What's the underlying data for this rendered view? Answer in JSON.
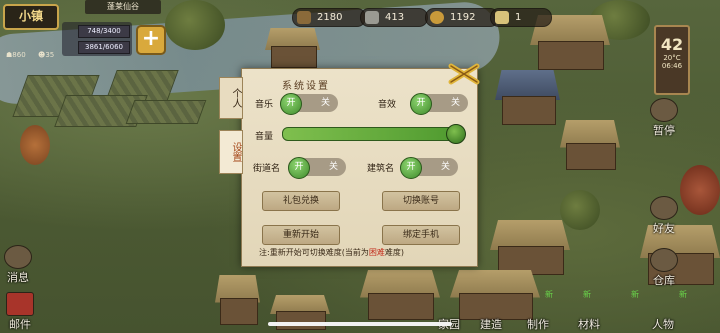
{
  "hud": {
    "town_label": "小镇",
    "place_name": "蓬莱仙谷",
    "population": "860",
    "workers": "35",
    "stat_top": "748/3400",
    "stat_bottom": "3861/6060",
    "plus_label": "+"
  },
  "resources": [
    {
      "value": "2180",
      "icon": "wood-log-icon",
      "color": "#8a6a3a"
    },
    {
      "value": "413",
      "icon": "stone-icon",
      "color": "#9a9a92"
    },
    {
      "value": "1192",
      "icon": "coin-icon",
      "color": "#c99a3a"
    },
    {
      "value": "1",
      "icon": "scroll-icon",
      "color": "#d8c27a"
    }
  ],
  "clock": {
    "day": "42",
    "temp": "20°C",
    "time": "06:46"
  },
  "right_side": {
    "pause": "暂停",
    "friends": "好友",
    "warehouse": "仓库"
  },
  "left_side": {
    "messages": "消息"
  },
  "bottom_bar": {
    "mail": "邮件",
    "new_badge": "新",
    "items": [
      "家园",
      "建造",
      "制作",
      "材料",
      "人物"
    ]
  },
  "dialog": {
    "title": "系统设置",
    "tabs": [
      "个人",
      "设置"
    ],
    "music_label": "音乐",
    "sfx_label": "音效",
    "volume_label": "音量",
    "street_name_label": "街道名",
    "building_name_label": "建筑名",
    "on": "开",
    "off": "关",
    "buttons": {
      "gift_code": "礼包兑换",
      "switch_account": "切换账号",
      "restart": "重新开始",
      "bind_phone": "绑定手机"
    },
    "note_prefix": "注:重新开始可切换难度(当前为",
    "note_difficulty": "困难",
    "note_suffix": "难度)",
    "volume_level": 0.97
  },
  "colors": {
    "accent_green": "#4f9a2f",
    "dialog_bg": "#e2d6b8",
    "warning_red": "#c22a1a"
  }
}
